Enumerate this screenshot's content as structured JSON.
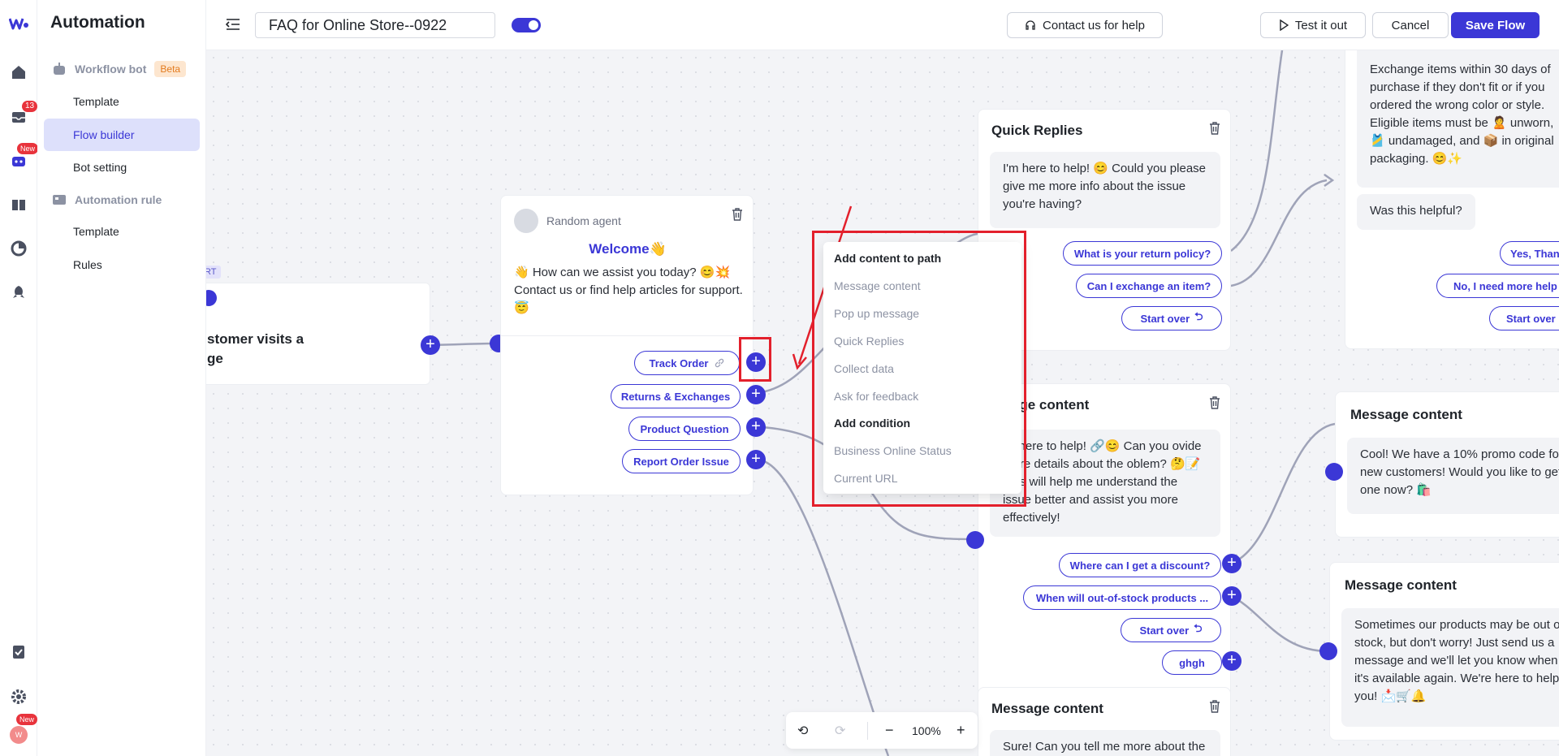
{
  "nav": {
    "badge_inbox": "13",
    "badge_bot": "New",
    "badge_user": "New",
    "avatar_initial": "W"
  },
  "sidebar": {
    "title": "Automation",
    "workflow_label": "Workflow bot",
    "beta": "Beta",
    "workflow_items": [
      "Template",
      "Flow builder",
      "Bot setting"
    ],
    "automation_label": "Automation rule",
    "automation_items": [
      "Template",
      "Rules"
    ]
  },
  "header": {
    "flow_name": "FAQ for Online Store--0922",
    "contact": "Contact us for help",
    "test": "Test it out",
    "cancel": "Cancel",
    "save": "Save Flow"
  },
  "start_node": {
    "tag": "RT",
    "text_line1": "stomer visits a",
    "text_line2": "ge"
  },
  "welcome_node": {
    "agent": "Random agent",
    "title": "Welcome👋",
    "body": "👋 How can we assist you today? 😊💥 Contact us or find help articles for support.😇",
    "buttons": [
      "Track Order",
      "Returns & Exchanges",
      "Product Question",
      "Report Order Issue"
    ]
  },
  "dropdown": {
    "header1": "Add content to path",
    "items1": [
      "Message content",
      "Pop up message",
      "Quick Replies",
      "Collect data",
      "Ask for feedback"
    ],
    "header2": "Add condition",
    "items2": [
      "Business Online Status",
      "Current URL"
    ]
  },
  "quick_replies": {
    "title": "Quick Replies",
    "msg": "I'm here to help! 😊 Could you please give me more info about the issue you're having?",
    "buttons": [
      "What is your return policy?",
      "Can I exchange an item?",
      "Start over"
    ]
  },
  "message_mid": {
    "title": "ssage content",
    "msg": "'m here to help! 🔗😊 Can you ovide more details about the oblem? 🤔📝 This will help me understand the issue better and assist you more effectively!",
    "buttons": [
      "Where can I get a discount?",
      "When will out-of-stock products ...",
      "Start over",
      "ghgh"
    ]
  },
  "message_bottom": {
    "title": "Message content",
    "msg": "Sure! Can you tell me more about the"
  },
  "exchange_card": {
    "msg": "Exchange items within 30 days of purchase if they don't fit or if you ordered the wrong color or style. Eligible items must be 🙎 unworn, 🎽 undamaged, and 📦 in original packaging. 😊✨",
    "helpful": "Was this helpful?",
    "buttons": [
      "Yes, Than",
      "No, I need more help",
      "Start over"
    ]
  },
  "promo_card": {
    "title": "Message content",
    "msg": "Cool! We have a 10% promo code for new customers! Would you like to get one now? 🛍️"
  },
  "stock_card": {
    "title": "Message content",
    "msg": "Sometimes our products may be out of stock, but don't worry! Just send us a message and we'll let you know when it's available again. We're here to help you! 📩🛒🔔"
  },
  "zoom": {
    "level": "100%"
  },
  "colors": {
    "accent": "#3b37d6",
    "highlight": "#e3202c"
  }
}
